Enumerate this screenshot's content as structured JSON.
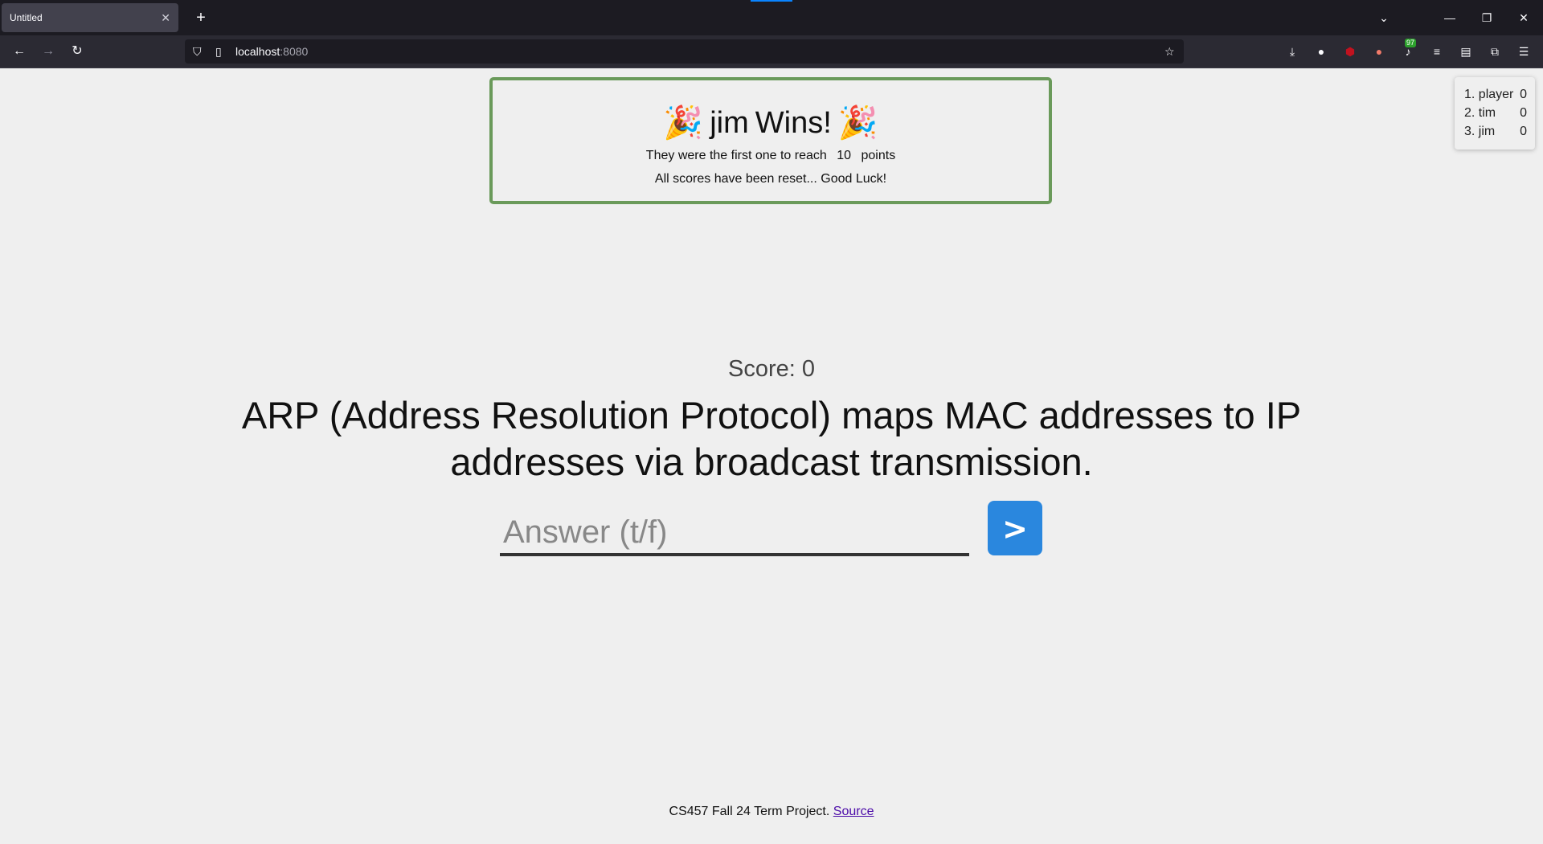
{
  "browser": {
    "tab_title": "Untitled",
    "tab_close": "✕",
    "new_tab": "+",
    "url_host": "localhost",
    "url_port": ":8080",
    "extension_badge": "97"
  },
  "banner": {
    "winner_name": "jim",
    "wins_label": "Wins!",
    "party_emoji": "🎉",
    "line1_prefix": "They were the first one to reach",
    "target_points": "10",
    "line1_suffix": "points",
    "line2": "All scores have been reset... Good Luck!",
    "border_color": "#6a9a5a"
  },
  "leaderboard": [
    {
      "rank_name": "1. player",
      "score": "0"
    },
    {
      "rank_name": "2. tim",
      "score": "0"
    },
    {
      "rank_name": "3. jim",
      "score": "0"
    }
  ],
  "game": {
    "score_text": "Score: 0",
    "question": "ARP (Address Resolution Protocol) maps MAC addresses to IP addresses via broadcast transmission.",
    "answer_placeholder": "Answer (t/f)",
    "answer_value": "",
    "submit_label": ">",
    "submit_color": "#2a87de"
  },
  "footer": {
    "text": "CS457 Fall 24 Term Project.",
    "link_text": "Source"
  }
}
